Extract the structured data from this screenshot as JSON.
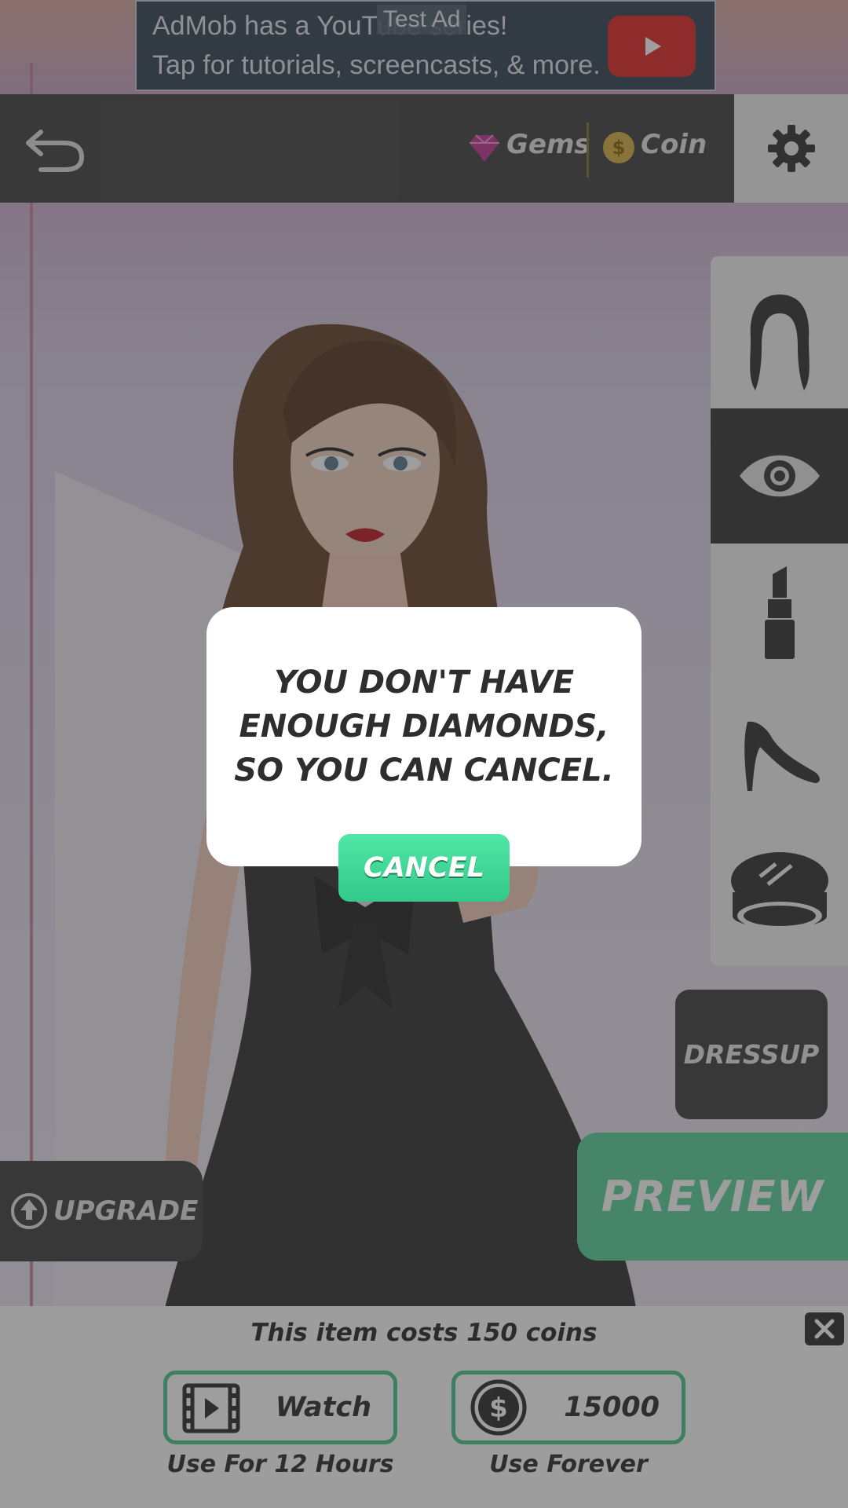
{
  "ad": {
    "line1": "AdMob has a YouTube series!",
    "line2": "Tap for tutorials, screencasts, & more.",
    "tag": "Test Ad"
  },
  "topbar": {
    "gems_label": "Gems",
    "coin_label": "Coin",
    "coin_symbol": "$"
  },
  "categories": [
    "hair-icon",
    "eye-icon",
    "lipstick-icon",
    "high-heel-icon",
    "compact-icon"
  ],
  "active_category": "eye-icon",
  "buttons": {
    "dressup": "DRESSUP",
    "preview": "PREVIEW",
    "upgrade": "UPGRADE"
  },
  "purchase": {
    "cost_text": "This item costs 150 coins",
    "watch_label": "Watch",
    "watch_sub": "Use For 12 Hours",
    "coins_value": "15000",
    "coins_sub": "Use Forever"
  },
  "dialog": {
    "message": "YOU DON'T HAVE\nENOUGH DIAMONDS,\nSO YOU CAN CANCEL.",
    "cancel_label": "CANCEL"
  },
  "colors": {
    "accent_green": "#4fc68e",
    "dark_panel": "#454545",
    "preview_green": "#5fd19b"
  }
}
